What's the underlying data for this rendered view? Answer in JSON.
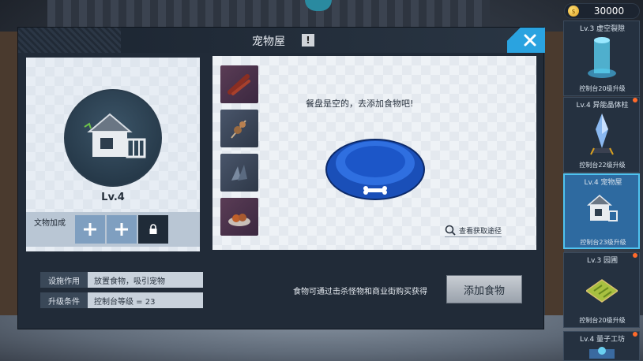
{
  "currency": {
    "amount": "30000",
    "icon": "coin-icon"
  },
  "panel": {
    "title": "宠物屋",
    "close_icon": "close-icon",
    "alert_icon": "exclamation-icon"
  },
  "building": {
    "level": "Lv.4",
    "relic_label": "文物加成",
    "relic_slots": [
      "plus-icon",
      "plus-icon",
      "lock-icon"
    ]
  },
  "feeding": {
    "empty_message": "餐盘是空的，去添加食物吧!",
    "view_source": "查看获取途径",
    "foods": [
      "food-item-1",
      "food-item-2",
      "food-item-3",
      "food-item-4"
    ]
  },
  "info": {
    "function_key": "设施作用",
    "function_val": "放置食物，吸引宠物",
    "upgrade_key": "升级条件",
    "upgrade_val": "控制台等级 = 23"
  },
  "footer": {
    "hint": "食物可通过击杀怪物和商业街购买获得",
    "add_food_label": "添加食物"
  },
  "sidebar": [
    {
      "title": "Lv.3 虚空裂隙",
      "sub": "控制台20级升级",
      "dot": false
    },
    {
      "title": "Lv.4 异能晶体柱",
      "sub": "控制台22级升级",
      "dot": true
    },
    {
      "title": "Lv.4 宠物屋",
      "sub": "控制台23级升级",
      "dot": false
    },
    {
      "title": "Lv.3 园圃",
      "sub": "控制台20级升级",
      "dot": true
    },
    {
      "title": "Lv.4 量子工坊",
      "sub": "",
      "dot": true
    }
  ],
  "colors": {
    "accent": "#2aa3e0",
    "panel": "#212b38",
    "active": "#2e6aa0"
  }
}
